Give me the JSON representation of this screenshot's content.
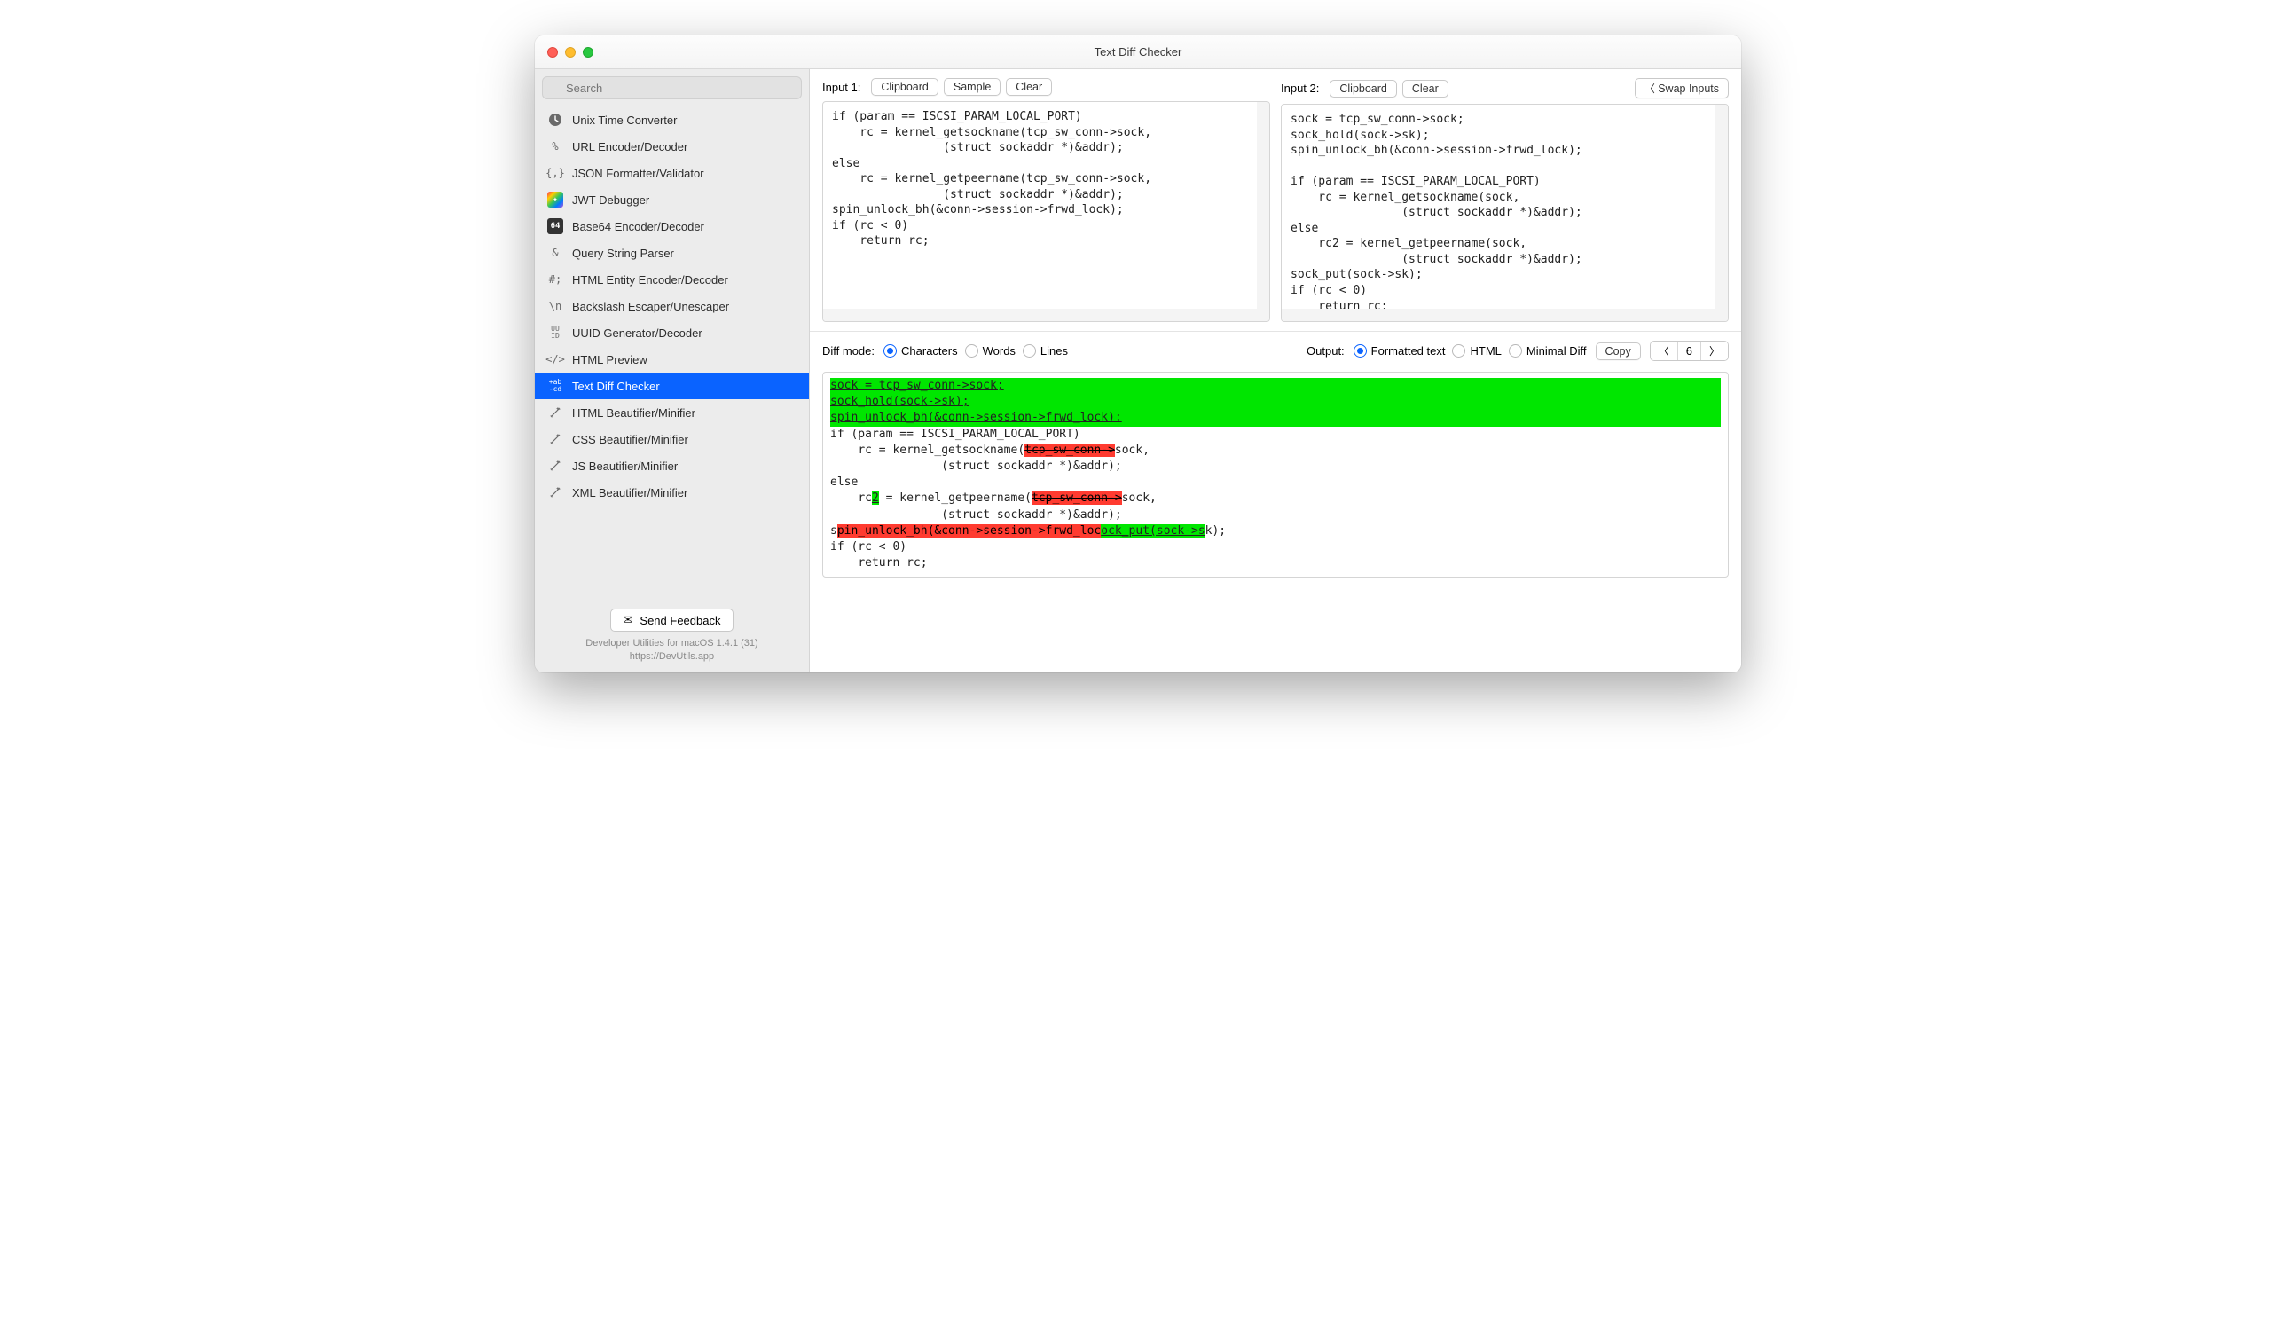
{
  "window": {
    "title": "Text Diff Checker"
  },
  "search": {
    "placeholder": "Search"
  },
  "sidebar": {
    "items": [
      {
        "label": "Unix Time Converter",
        "icon": "clock"
      },
      {
        "label": "URL Encoder/Decoder",
        "icon": "percent"
      },
      {
        "label": "JSON Formatter/Validator",
        "icon": "braces"
      },
      {
        "label": "JWT Debugger",
        "icon": "jwt"
      },
      {
        "label": "Base64 Encoder/Decoder",
        "icon": "b64"
      },
      {
        "label": "Query String Parser",
        "icon": "amp"
      },
      {
        "label": "HTML Entity Encoder/Decoder",
        "icon": "hashsemi"
      },
      {
        "label": "Backslash Escaper/Unescaper",
        "icon": "backslash"
      },
      {
        "label": "UUID Generator/Decoder",
        "icon": "uuid"
      },
      {
        "label": "HTML Preview",
        "icon": "angles"
      },
      {
        "label": "Text Diff Checker",
        "icon": "diff",
        "active": true
      },
      {
        "label": "HTML Beautifier/Minifier",
        "icon": "wand"
      },
      {
        "label": "CSS Beautifier/Minifier",
        "icon": "wand"
      },
      {
        "label": "JS Beautifier/Minifier",
        "icon": "wand"
      },
      {
        "label": "XML Beautifier/Minifier",
        "icon": "wand"
      }
    ]
  },
  "feedback": {
    "label": "Send Feedback"
  },
  "footer": {
    "line1": "Developer Utilities for macOS 1.4.1 (31)",
    "line2": "https://DevUtils.app"
  },
  "input1": {
    "label": "Input 1:",
    "btn_clipboard": "Clipboard",
    "btn_sample": "Sample",
    "btn_clear": "Clear",
    "text": "if (param == ISCSI_PARAM_LOCAL_PORT)\n    rc = kernel_getsockname(tcp_sw_conn->sock,\n                (struct sockaddr *)&addr);\nelse\n    rc = kernel_getpeername(tcp_sw_conn->sock,\n                (struct sockaddr *)&addr);\nspin_unlock_bh(&conn->session->frwd_lock);\nif (rc < 0)\n    return rc;"
  },
  "input2": {
    "label": "Input 2:",
    "btn_clipboard": "Clipboard",
    "btn_clear": "Clear",
    "btn_swap": "Swap Inputs",
    "text": "sock = tcp_sw_conn->sock;\nsock_hold(sock->sk);\nspin_unlock_bh(&conn->session->frwd_lock);\n\nif (param == ISCSI_PARAM_LOCAL_PORT)\n    rc = kernel_getsockname(sock,\n                (struct sockaddr *)&addr);\nelse\n    rc2 = kernel_getpeername(sock,\n                (struct sockaddr *)&addr);\nsock_put(sock->sk);\nif (rc < 0)\n    return rc;"
  },
  "controls": {
    "diff_mode_label": "Diff mode:",
    "mode_chars": "Characters",
    "mode_words": "Words",
    "mode_lines": "Lines",
    "mode_selected": "Characters",
    "output_label": "Output:",
    "out_formatted": "Formatted text",
    "out_html": "HTML",
    "out_minimal": "Minimal Diff",
    "out_selected": "Formatted text",
    "copy": "Copy",
    "nav_count": "6"
  },
  "diff": {
    "add_block_l1": "sock = tcp_sw_conn->sock;",
    "add_block_l2": "sock_hold(sock->sk);",
    "add_block_l3": "spin_unlock_bh(&conn->session->frwd_lock);",
    "line_if": "if (param == ISCSI_PARAM_LOCAL_PORT)",
    "line_rc_pre": "    rc = kernel_getsockname(",
    "del_tcp1": "tcp_sw_conn->",
    "line_rc_post": "sock,",
    "line_struct": "                (struct sockaddr *)&addr);",
    "line_else": "else",
    "line_rc2_pre": "    rc",
    "add_2": "2",
    "line_rc2_mid": " = kernel_getpeername(",
    "del_tcp2": "tcp_sw_conn->",
    "line_rc2_post": "sock,",
    "line_s": "s",
    "del_spin": "pin_unlock_bh(&conn->session->frwd_loc",
    "add_sock_put": "ock_put(sock->s",
    "line_k": "k);",
    "line_if2": "if (rc < 0)",
    "line_ret": "    return rc;"
  }
}
